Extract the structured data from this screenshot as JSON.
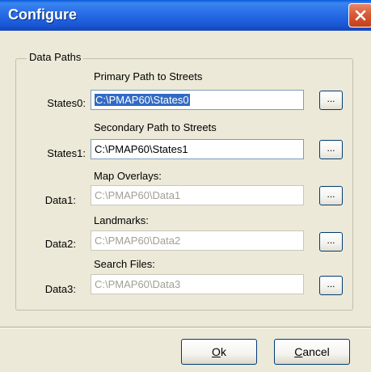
{
  "window": {
    "title": "Configure",
    "close_icon": "close-icon"
  },
  "group": {
    "label": "Data Paths"
  },
  "rows": [
    {
      "heading": "Primary Path to Streets",
      "label": "States0:",
      "value": "C:\\PMAP60\\States0",
      "enabled": true,
      "selected": true,
      "browse_label": "..."
    },
    {
      "heading": "Secondary Path to Streets",
      "label": "States1:",
      "value": "C:\\PMAP60\\States1",
      "enabled": true,
      "selected": false,
      "browse_label": "..."
    },
    {
      "heading": "Map Overlays:",
      "label": "Data1:",
      "value": "C:\\PMAP60\\Data1",
      "enabled": false,
      "selected": false,
      "browse_label": "..."
    },
    {
      "heading": "Landmarks:",
      "label": "Data2:",
      "value": "C:\\PMAP60\\Data2",
      "enabled": false,
      "selected": false,
      "browse_label": "..."
    },
    {
      "heading": "Search Files:",
      "label": "Data3:",
      "value": "C:\\PMAP60\\Data3",
      "enabled": false,
      "selected": false,
      "browse_label": "..."
    }
  ],
  "buttons": {
    "ok": {
      "accel": "O",
      "rest": "k"
    },
    "cancel": {
      "accel": "C",
      "rest": "ancel"
    }
  },
  "colors": {
    "titlebar": "#2a6fe8",
    "selection": "#316ac5",
    "disabled_text": "#a19f94"
  }
}
